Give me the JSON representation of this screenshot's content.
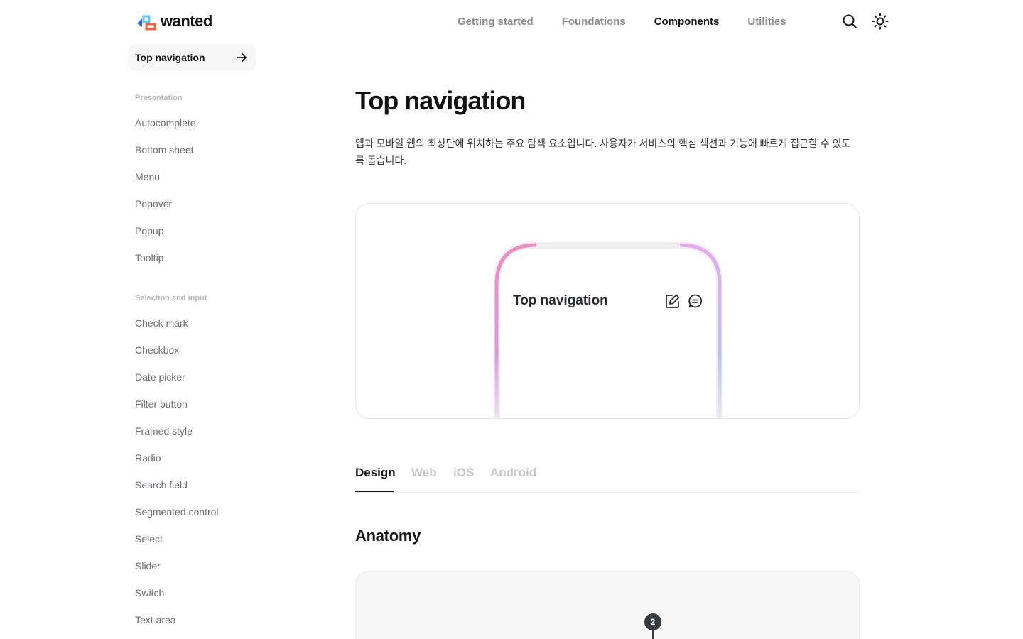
{
  "header": {
    "logo_text": "wanted",
    "nav": [
      "Getting started",
      "Foundations",
      "Components",
      "Utilities"
    ],
    "active_nav": "Components",
    "icons": [
      "search-icon",
      "sun-icon"
    ]
  },
  "sidebar": {
    "current_page": "Top navigation",
    "sections": [
      {
        "label": "Presentation",
        "items": [
          "Autocomplete",
          "Bottom sheet",
          "Menu",
          "Popover",
          "Popup",
          "Tooltip"
        ]
      },
      {
        "label": "Selection and input",
        "items": [
          "Check mark",
          "Checkbox",
          "Date picker",
          "Filter button",
          "Framed style",
          "Radio",
          "Search field",
          "Segmented control",
          "Select",
          "Slider",
          "Switch",
          "Text area"
        ]
      }
    ]
  },
  "main": {
    "title": "Top navigation",
    "description": "앱과 모바일 웹의 최상단에 위치하는 주요 탐색 요소입니다. 사용자가 서비스의 핵심 섹션과 기능에 빠르게 접근할 수 있도록 돕습니다.",
    "preview": {
      "title": "Top navigation",
      "icons": [
        "edit-icon",
        "chat-icon"
      ]
    },
    "tabs": [
      "Design",
      "Web",
      "iOS",
      "Android"
    ],
    "active_tab": "Design",
    "anatomy": {
      "title": "Anatomy",
      "marker": "2"
    }
  }
}
